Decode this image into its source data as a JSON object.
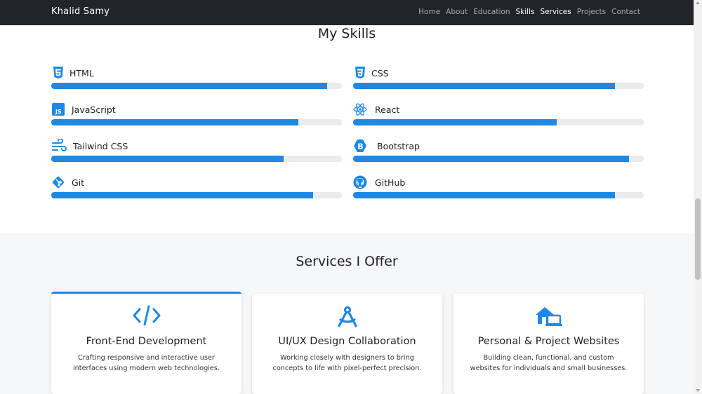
{
  "brand": "Khalid Samy",
  "nav": [
    {
      "label": "Home",
      "active": false
    },
    {
      "label": "About",
      "active": false
    },
    {
      "label": "Education",
      "active": false
    },
    {
      "label": "Skills",
      "active": true
    },
    {
      "label": "Services",
      "active": true
    },
    {
      "label": "Projects",
      "active": false
    },
    {
      "label": "Contact",
      "active": false
    }
  ],
  "skills": {
    "title": "My Skills",
    "items": [
      {
        "label": "HTML",
        "icon": "html5-icon",
        "level": 0.95
      },
      {
        "label": "CSS",
        "icon": "css3-icon",
        "level": 0.9
      },
      {
        "label": "JavaScript",
        "icon": "javascript-icon",
        "level": 0.85
      },
      {
        "label": "React",
        "icon": "react-icon",
        "level": 0.7
      },
      {
        "label": "Tailwind CSS",
        "icon": "tailwind-icon",
        "level": 0.8
      },
      {
        "label": "Bootstrap",
        "icon": "bootstrap-icon",
        "level": 0.95
      },
      {
        "label": "Git",
        "icon": "git-icon",
        "level": 0.9
      },
      {
        "label": "GitHub",
        "icon": "github-icon",
        "level": 0.9
      }
    ]
  },
  "services": {
    "title": "Services I Offer",
    "cards": [
      {
        "title": "Front-End Development",
        "icon": "code-icon",
        "desc": "Crafting responsive and interactive user interfaces using modern web technologies."
      },
      {
        "title": "UI/UX Design Collaboration",
        "icon": "compass-drafting-icon",
        "desc": "Working closely with designers to bring concepts to life with pixel-perfect precision."
      },
      {
        "title": "Personal & Project Websites",
        "icon": "house-laptop-icon",
        "desc": "Building clean, functional, and custom websites for individuals and small businesses."
      }
    ]
  },
  "colors": {
    "accent": "#1e88e5",
    "navbar": "#212529",
    "track": "#e9ecef",
    "section_bg": "#f6f7f9"
  }
}
